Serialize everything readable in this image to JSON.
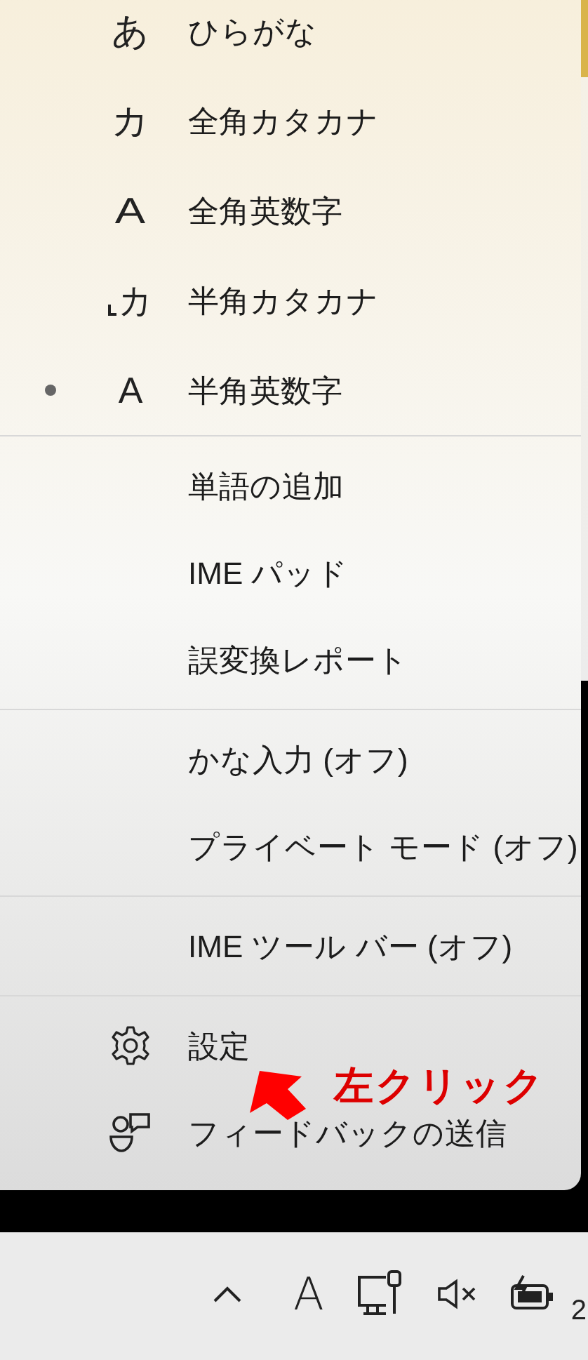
{
  "menu": {
    "sections": [
      {
        "items": [
          {
            "label": "ひらがな",
            "selected": false,
            "icon": {
              "kind": "glyph",
              "text": "あ"
            }
          },
          {
            "label": "全角カタカナ",
            "selected": false,
            "icon": {
              "kind": "glyph",
              "text": "カ"
            }
          },
          {
            "label": "全角英数字",
            "selected": false,
            "icon": {
              "kind": "glyph-wide",
              "text": "A"
            }
          },
          {
            "label": "半角カタカナ",
            "selected": false,
            "icon": {
              "kind": "glyph-bracket",
              "text": "カ"
            }
          },
          {
            "label": "半角英数字",
            "selected": true,
            "icon": {
              "kind": "glyph",
              "text": "A"
            }
          }
        ]
      },
      {
        "items": [
          {
            "label": "単語の追加"
          },
          {
            "label": "IME パッド"
          },
          {
            "label": "誤変換レポート"
          }
        ]
      },
      {
        "items": [
          {
            "label": "かな入力 (オフ)"
          },
          {
            "label": "プライベート モード (オフ)"
          }
        ]
      },
      {
        "items": [
          {
            "label": "IME ツール バー (オフ)"
          }
        ]
      },
      {
        "items": [
          {
            "label": "設定",
            "icon": {
              "kind": "gear"
            }
          },
          {
            "label": "フィードバックの送信",
            "icon": {
              "kind": "feedback"
            }
          }
        ]
      }
    ]
  },
  "annotation": {
    "label": "左クリック"
  },
  "taskbar": {
    "ime_indicator": "A",
    "clock": "2"
  }
}
